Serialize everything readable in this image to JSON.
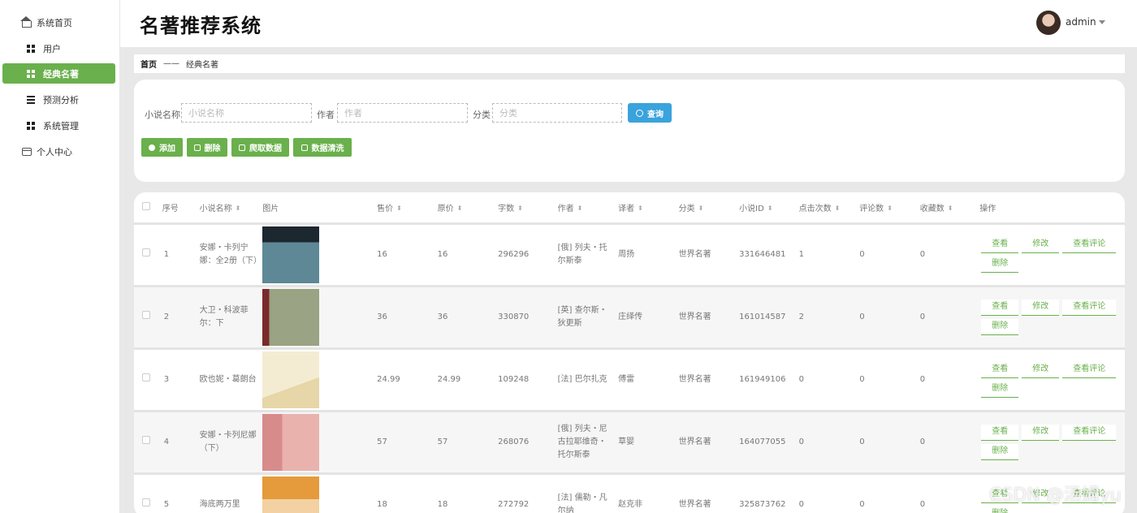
{
  "app": {
    "title": "名著推荐系统"
  },
  "user": {
    "name": "admin"
  },
  "sidebar": {
    "items": [
      {
        "label": "系统首页",
        "icon": "home-icon"
      },
      {
        "label": "用户",
        "icon": "grid-icon"
      },
      {
        "label": "经典名著",
        "icon": "grid-icon",
        "active": true
      },
      {
        "label": "预测分析",
        "icon": "list-icon"
      },
      {
        "label": "系统管理",
        "icon": "grid-icon"
      },
      {
        "label": "个人中心",
        "icon": "card-icon"
      }
    ]
  },
  "breadcrumb": {
    "home": "首页",
    "separator": "——",
    "current": "经典名著"
  },
  "search": {
    "name_label": "小说名称",
    "name_placeholder": "小说名称",
    "author_label": "作者",
    "author_placeholder": "作者",
    "category_label": "分类",
    "category_placeholder": "分类",
    "query_label": "查询"
  },
  "actions": {
    "add": "添加",
    "delete": "删除",
    "crawl": "爬取数据",
    "clean": "数据清洗"
  },
  "table": {
    "columns": [
      "序号",
      "小说名称",
      "图片",
      "售价",
      "原价",
      "字数",
      "作者",
      "译者",
      "分类",
      "小说ID",
      "点击次数",
      "评论数",
      "收藏数",
      "操作"
    ],
    "ops": {
      "view": "查看",
      "edit": "修改",
      "review": "查看评论",
      "delete": "删除"
    },
    "rows": [
      {
        "no": "1",
        "name": "安娜・卡列宁娜：全2册（下）",
        "price": "16",
        "orig": "16",
        "words": "296296",
        "author": "[俄] 列夫・托尔斯泰",
        "translator": "周扬",
        "category": "世界名著",
        "id": "331646481",
        "clicks": "1",
        "comments": "0",
        "favorites": "0",
        "cover": "slate"
      },
      {
        "no": "2",
        "name": "大卫・科波菲尔：下",
        "price": "36",
        "orig": "36",
        "words": "330870",
        "author": "[英] 查尔斯・狄更斯",
        "translator": "庄绎传",
        "category": "世界名著",
        "id": "161014587",
        "clicks": "2",
        "comments": "0",
        "favorites": "0",
        "cover": "olive"
      },
      {
        "no": "3",
        "name": "欧也妮・葛朗台",
        "price": "24.99",
        "orig": "24.99",
        "words": "109248",
        "author": "[法] 巴尔扎克",
        "translator": "傅雷",
        "category": "世界名著",
        "id": "161949106",
        "clicks": "0",
        "comments": "0",
        "favorites": "0",
        "cover": "cream"
      },
      {
        "no": "4",
        "name": "安娜・卡列尼娜（下）",
        "price": "57",
        "orig": "57",
        "words": "268076",
        "author": "[俄] 列夫・尼古拉耶维奇・托尔斯泰",
        "translator": "草婴",
        "category": "世界名著",
        "id": "164077055",
        "clicks": "0",
        "comments": "0",
        "favorites": "0",
        "cover": "pink"
      },
      {
        "no": "5",
        "name": "海底两万里",
        "price": "18",
        "orig": "18",
        "words": "272792",
        "author": "[法] 儒勒・凡尔纳",
        "translator": "赵克非",
        "category": "世界名著",
        "id": "325873762",
        "clicks": "0",
        "comments": "0",
        "favorites": "0",
        "cover": "orange"
      }
    ]
  },
  "watermark": "CSDN @汤姆yu",
  "colors": {
    "accent": "#6ab04c",
    "query": "#3aa3dc"
  }
}
